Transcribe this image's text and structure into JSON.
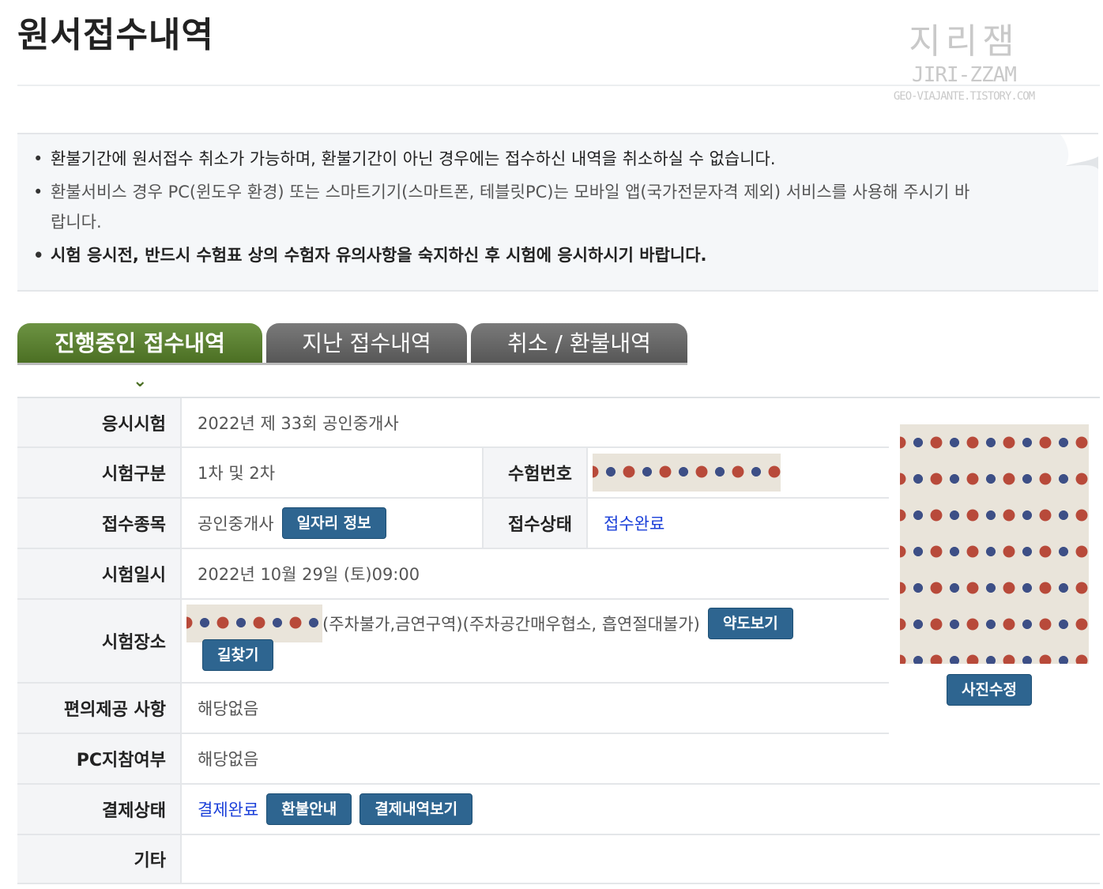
{
  "page_title": "원서접수내역",
  "watermark": {
    "korean": "지리잼",
    "english": "JIRI-ZZAM",
    "site": "GEO-VIAJANTE.TISTORY.COM"
  },
  "notices": [
    "환불기간에 원서접수 취소가 가능하며, 환불기간이 아닌 경우에는 접수하신 내역을 취소하실 수 없습니다.",
    "환불서비스 경우 PC(윈도우 환경) 또는 스마트기기(스마트폰, 테블릿PC)는 모바일 앱(국가전문자격 제외) 서비스를 사용해 주시기 바랍니다.",
    "시험 응시전, 반드시 수험표 상의 수험자 유의사항을 숙지하신 후 시험에 응시하시기 바랍니다."
  ],
  "tabs": [
    "진행중인 접수내역",
    "지난 접수내역",
    "취소 / 환불내역"
  ],
  "tab_arrow": "⌄",
  "labels": {
    "exam": "응시시험",
    "category": "시험구분",
    "exam_number": "수험번호",
    "subject": "접수종목",
    "status": "접수상태",
    "date": "시험일시",
    "venue": "시험장소",
    "convenience": "편의제공 사항",
    "pc": "PC지참여부",
    "payment": "결제상태",
    "etc": "기타"
  },
  "values": {
    "exam": "2022년 제 33회 공인중개사",
    "category": "1차 및 2차",
    "subject": "공인중개사",
    "status": "접수완료",
    "date": "2022년 10월 29일 (토)09:00",
    "venue_note": "(주차불가,금연구역)(주차공간매우협소, 흡연절대불가)",
    "convenience": "해당없음",
    "pc": "해당없음",
    "payment": "결제완료",
    "etc": ""
  },
  "buttons": {
    "job_info": "일자리 정보",
    "map": "약도보기",
    "directions": "길찾기",
    "photo_edit": "사진수정",
    "refund_guide": "환불안내",
    "payment_history": "결제내역보기"
  },
  "colors": {
    "active_tab": "#5a7f2e",
    "inactive_tab": "#666666",
    "button": "#2e6590",
    "link": "#1a3fd9"
  }
}
